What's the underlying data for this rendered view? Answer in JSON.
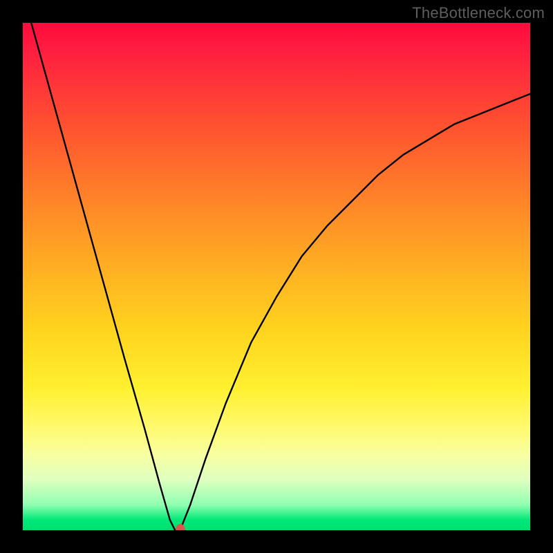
{
  "watermark": "TheBottleneck.com",
  "chart_data": {
    "type": "line",
    "title": "",
    "xlabel": "",
    "ylabel": "",
    "xlim": [
      0,
      100
    ],
    "ylim": [
      0,
      100
    ],
    "grid": false,
    "series": [
      {
        "name": "bottleneck-curve",
        "x": [
          0,
          5,
          10,
          15,
          20,
          24,
          27,
          29,
          30,
          31,
          33,
          36,
          40,
          45,
          50,
          55,
          60,
          65,
          70,
          75,
          80,
          85,
          90,
          95,
          100
        ],
        "values": [
          106,
          88,
          70,
          52,
          34,
          20,
          9,
          2,
          0,
          0,
          5,
          14,
          25,
          37,
          46,
          54,
          60,
          65,
          70,
          74,
          77,
          80,
          82,
          84,
          86
        ]
      }
    ],
    "marker": {
      "x": 31,
      "y": 0,
      "color": "#d9594e"
    }
  },
  "colors": {
    "curve": "#000000",
    "background_top": "#ff0a3c",
    "background_bottom": "#00e070",
    "frame": "#000000"
  }
}
